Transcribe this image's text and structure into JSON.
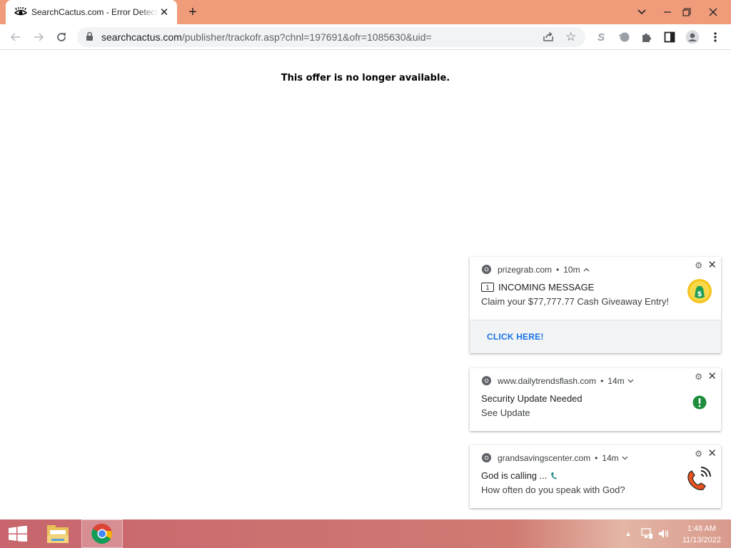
{
  "tab": {
    "title": "SearchCactus.com - Error Detected",
    "close_glyph": "✕",
    "new_tab_glyph": "+"
  },
  "window_controls": {
    "dropdown": "⌄",
    "minimize": "–",
    "restore": "❐",
    "close": "✕"
  },
  "toolbar": {
    "url_host": "searchcactus.com",
    "url_path": "/publisher/trackofr.asp?chnl=197691&ofr=1085630&uid="
  },
  "page": {
    "message": "This offer is no longer available."
  },
  "notifications": [
    {
      "site": "prizegrab.com",
      "age": "10m",
      "expanded": true,
      "title": "INCOMING MESSAGE",
      "title_badge": "1",
      "body": "Claim your $77,777.77 Cash Giveaway Entry!",
      "action": "CLICK HERE!",
      "icon": "money-bag-icon"
    },
    {
      "site": "www.dailytrendsflash.com",
      "age": "14m",
      "expanded": false,
      "title": "Security Update Needed",
      "body": "See Update",
      "icon": "exclamation-icon"
    },
    {
      "site": "grandsavingscenter.com",
      "age": "14m",
      "expanded": false,
      "title": "God is calling ...",
      "body": "How often do you speak with God?",
      "icon": "phone-ringing-icon"
    }
  ],
  "taskbar": {
    "time": "1:48 AM",
    "date": "11/13/2022"
  },
  "colors": {
    "tabstrip": "#f09c7a",
    "accent_link": "#1a73e8",
    "taskbar": "#c8656e",
    "success_green": "#1e8e3e",
    "phone_orange": "#e8531f"
  }
}
